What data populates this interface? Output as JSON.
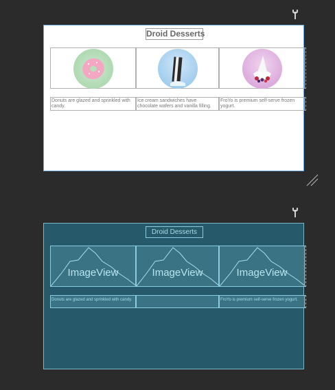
{
  "design": {
    "title": "Droid Desserts",
    "items": [
      {
        "image": "donut-image",
        "description": "Donuts are glazed and sprinkled with candy."
      },
      {
        "image": "icecream-sandwich-image",
        "description": "Ice cream sandwiches have chocolate wafers and vanilla filling."
      },
      {
        "image": "froyo-image",
        "description": "FroYo is premium self-serve frozen yogurt."
      }
    ]
  },
  "blueprint": {
    "title": "Droid Desserts",
    "image_label": "ImageView",
    "descriptions": [
      "Donuts are glazed and sprinkled with candy.",
      "",
      "FroYo is premium self-serve frozen yogurt."
    ]
  },
  "icons": {
    "design_tools": "wrench-icon",
    "blueprint_tools": "wrench-icon",
    "resize": "resize-handle-icon"
  },
  "colors": {
    "background": "#2b2b2b",
    "blueprint_bg": "#265a6a",
    "blueprint_line": "#8ccce0",
    "selection": "#6aa7d8"
  }
}
